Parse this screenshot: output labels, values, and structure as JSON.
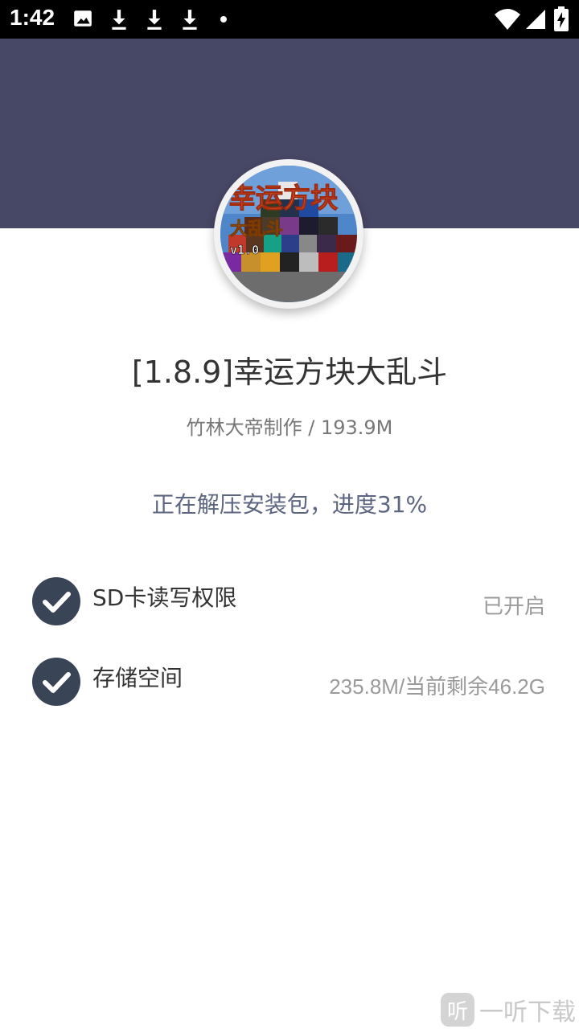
{
  "status_bar": {
    "time": "1:42",
    "icons": [
      "image-icon",
      "download-icon",
      "download-icon",
      "download-icon",
      "dot-icon",
      "wifi-icon",
      "signal-icon",
      "battery-charging-icon"
    ]
  },
  "app": {
    "title": "[1.8.9]幸运方块大乱斗",
    "subtitle": "竹林大帝制作 / 193.9M",
    "progress_text": "正在解压安装包，进度31%",
    "progress_percent": 31,
    "icon_text_line1": "幸运方块",
    "icon_text_line2": "大乱斗",
    "icon_version": "v1.0"
  },
  "permissions": [
    {
      "label": "SD卡读写权限",
      "value": "已开启",
      "checked": true
    },
    {
      "label": "存储空间",
      "value": "235.8M/当前剩余46.2G",
      "checked": true
    }
  ],
  "watermark": {
    "text": "一听下载",
    "icon_char": "听"
  },
  "colors": {
    "header": "#474766",
    "check": "#3a4457",
    "progress_text": "#5d6680"
  }
}
